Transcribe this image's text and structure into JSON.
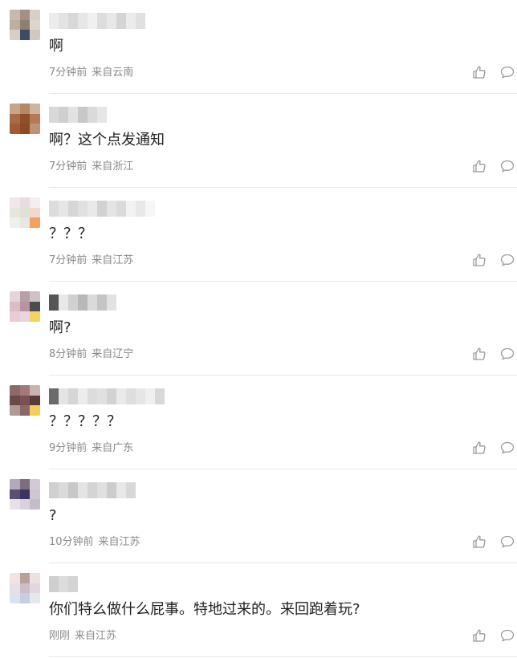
{
  "comments": [
    {
      "text": "啊",
      "time": "7分钟前",
      "location": "来自云南",
      "avatar_colors": [
        "#c9b8ae",
        "#a58f83",
        "#d9cfc6",
        "#bfae9f",
        "#8e7f74",
        "#ded6cc",
        "#d6cfc9",
        "#3f4a63",
        "#cfc8c3"
      ],
      "name_blur_colors": [
        "#ececec",
        "#e3e3e3",
        "#d8d8d8",
        "#e6e6e6",
        "#f0f0f0",
        "#dddddd",
        "#e8e8e8",
        "#d4d4d4",
        "#ebebeb",
        "#e0e0e0"
      ]
    },
    {
      "text": "啊？这个点发通知",
      "time": "7分钟前",
      "location": "来自浙江",
      "avatar_colors": [
        "#c6a58a",
        "#b3896a",
        "#d1b49e",
        "#a86b45",
        "#8e4f2a",
        "#b57a55",
        "#a15c36",
        "#8c4a25",
        "#c09274"
      ],
      "name_blur_colors": [
        "#d8d8d8",
        "#cfcfcf",
        "#e2e2e2",
        "#c8c8c8",
        "#dadada",
        "#e6e6e6"
      ]
    },
    {
      "text": "？？？",
      "time": "7分钟前",
      "location": "来自江苏",
      "avatar_colors": [
        "#f1e6ea",
        "#eadbe0",
        "#f5eef0",
        "#e4e6dc",
        "#dde2d3",
        "#f2d9cc",
        "#eef0ea",
        "#e8e8e2",
        "#f2a064"
      ],
      "name_blur_colors": [
        "#dcdcdc",
        "#e6e6e6",
        "#d6d6d6",
        "#e0e0e0",
        "#e9e9e9",
        "#d2d2d2",
        "#e4e4e4",
        "#dadada",
        "#f2f2f2",
        "#e8e8e8",
        "#f6f6f6"
      ]
    },
    {
      "text": "啊?",
      "time": "8分钟前",
      "location": "来自辽宁",
      "avatar_colors": [
        "#e6d4da",
        "#b5a0a8",
        "#cfc2c6",
        "#d9bcc4",
        "#b893a2",
        "#4e4b4d",
        "#e7ccd5",
        "#e9d6dc",
        "#f3d361"
      ],
      "name_blur_colors": [
        "#555555",
        "#e8e8e8",
        "#d0d0d0",
        "#b8b8b8",
        "#dadada",
        "#c4c4c4",
        "#e2e2e2"
      ]
    },
    {
      "text": "？？？？？",
      "time": "9分钟前",
      "location": "来自广东",
      "avatar_colors": [
        "#8c6a6a",
        "#a07a76",
        "#c9b3b0",
        "#6a4a48",
        "#7a5050",
        "#5a3a3a",
        "#b09a98",
        "#8a6868",
        "#f2cf5c"
      ],
      "name_blur_colors": [
        "#6a6a6a",
        "#e4e4e4",
        "#d6d6d6",
        "#ececec",
        "#dcdcdc",
        "#e0e0e0",
        "#d2d2d2",
        "#eaeaea",
        "#dedede",
        "#e6e6e6",
        "#f0f0f0",
        "#d8d8d8"
      ]
    },
    {
      "text": "?",
      "time": "10分钟前",
      "location": "来自江苏",
      "avatar_colors": [
        "#b3a9b8",
        "#7b6e7e",
        "#d2cbd4",
        "#5a4e72",
        "#3a3560",
        "#cfc6d2",
        "#e6e0e8",
        "#d9d2dc",
        "#c4bcc8"
      ],
      "name_blur_colors": [
        "#d0d0d0",
        "#dadada",
        "#c8c8c8",
        "#e4e4e4",
        "#d4d4d4",
        "#e0e0e0",
        "#cccccc",
        "#e8e8e8",
        "#d8d8d8"
      ]
    },
    {
      "text": "你们特么做什么屁事。特地过来的。来回跑着玩?",
      "time": "刚刚",
      "location": "来自江苏",
      "avatar_colors": [
        "#f1e3e4",
        "#b9a19b",
        "#eee0e2",
        "#e7dfe6",
        "#cbbec6",
        "#e2d6e0",
        "#dde3ee",
        "#c8cde2",
        "#e6e8f0"
      ],
      "name_blur_colors": [
        "#cfcfcf",
        "#dcdcdc",
        "#d4d4d4"
      ]
    }
  ],
  "icons": {
    "like": "thumbs-up-icon",
    "reply": "speech-bubble-icon"
  },
  "colors": {
    "text": "#222222",
    "meta": "#8a8a8a",
    "icon": "#9a9a9a",
    "divider": "#e9e9e9"
  }
}
